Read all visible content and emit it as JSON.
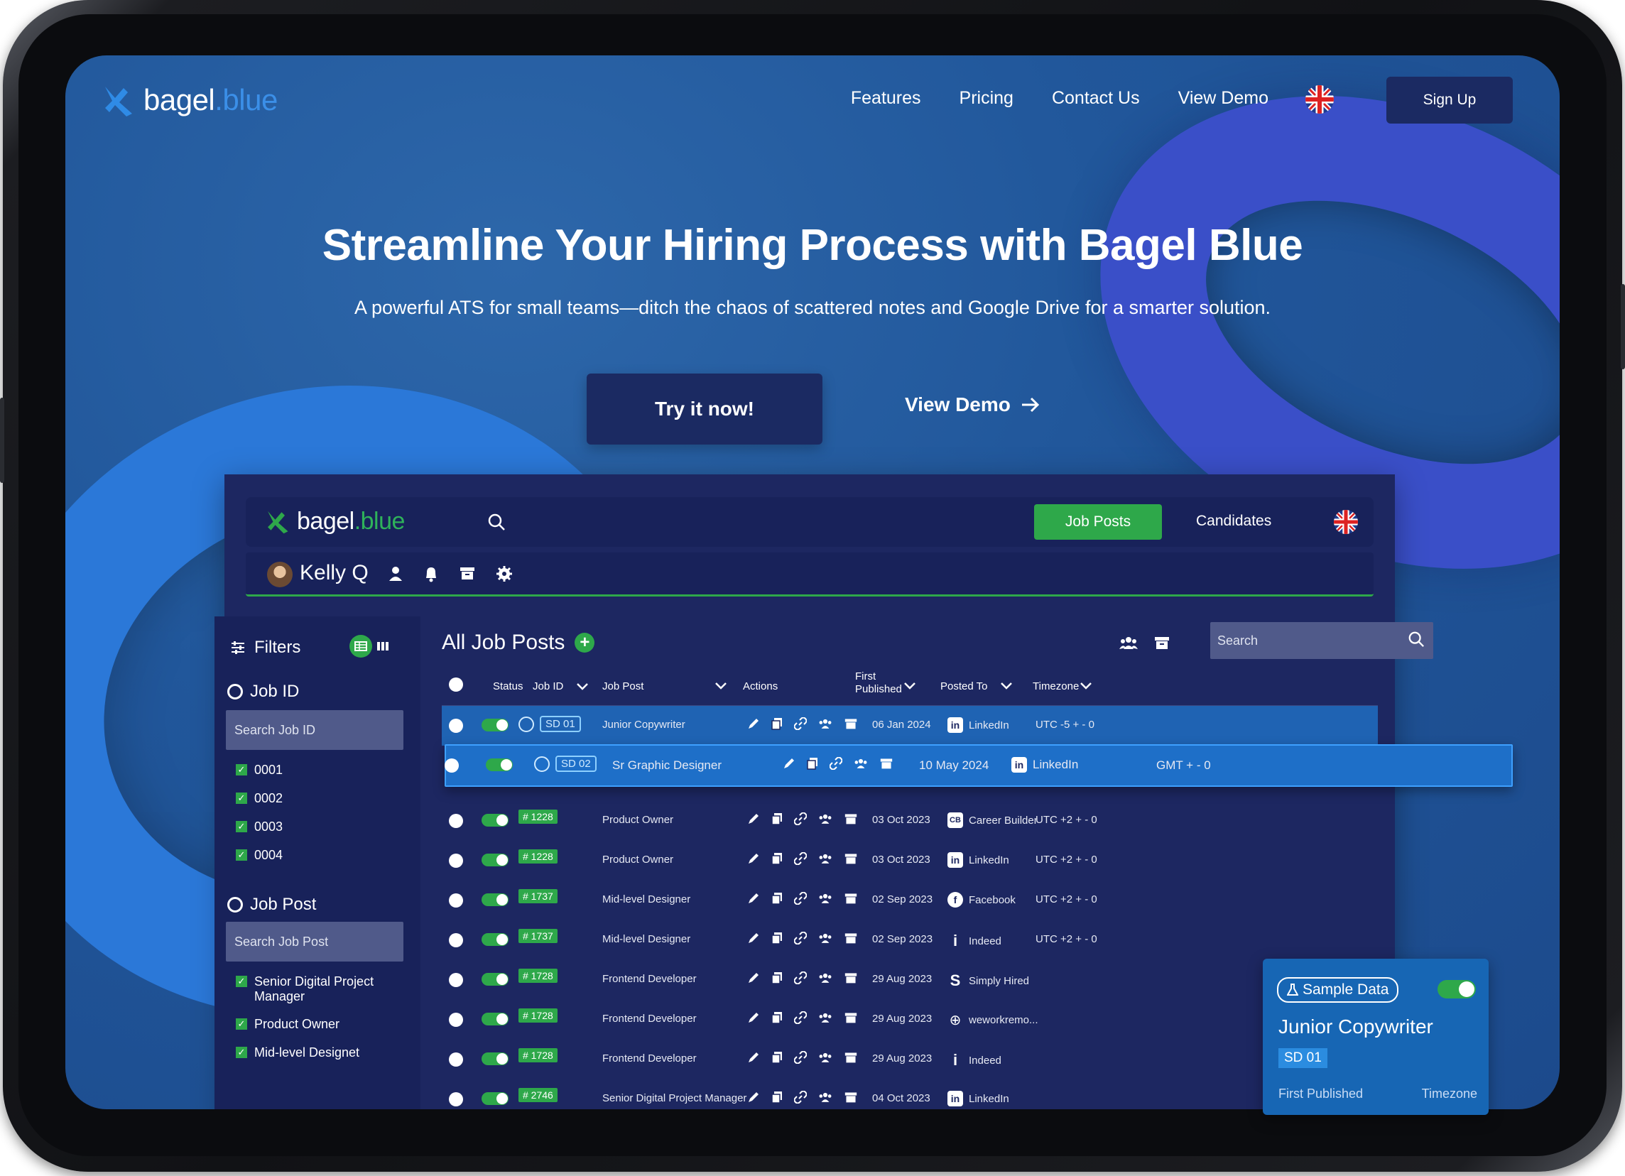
{
  "brand": {
    "name_main": "bagel",
    "name_accent": ".blue"
  },
  "nav": {
    "links": [
      "Features",
      "Pricing",
      "Contact Us",
      "View Demo"
    ],
    "signup_label": "Sign Up"
  },
  "hero": {
    "title": "Streamline Your Hiring Process with Bagel Blue",
    "subtitle": "A powerful ATS for small teams—ditch the chaos of scattered notes and Google Drive for a smarter solution.",
    "cta_primary": "Try it now!",
    "cta_secondary": "View Demo"
  },
  "app": {
    "tabs": {
      "job_posts": "Job Posts",
      "candidates": "Candidates"
    },
    "user_name": "Kelly Q",
    "filters": {
      "title": "Filters",
      "job_id_label": "Job ID",
      "job_id_search_placeholder": "Search Job ID",
      "job_ids": [
        "0001",
        "0002",
        "0003",
        "0004"
      ],
      "job_post_label": "Job Post",
      "job_post_search_placeholder": "Search Job Post",
      "job_posts": [
        "Senior Digital Project Manager",
        "Product Owner",
        "Mid-level Designet"
      ]
    },
    "main": {
      "title": "All Job Posts",
      "search_placeholder": "Search",
      "columns": {
        "status": "Status",
        "job_id": "Job ID",
        "job_post": "Job Post",
        "actions": "Actions",
        "first_published": "First Published",
        "posted_to": "Posted To",
        "timezone": "Timezone"
      },
      "rows": [
        {
          "id": "SD  01",
          "post": "Junior Copywriter",
          "date": "06 Jan 2024",
          "platform": "LinkedIn",
          "tz": "UTC -5 + - 0"
        },
        {
          "id": "SD  02",
          "post": "Sr Graphic Designer",
          "date": "10 May 2024",
          "platform": "LinkedIn",
          "tz": "GMT + - 0"
        },
        {
          "id": "# 1228",
          "post": "Product Owner",
          "date": "03 Oct 2023",
          "platform": "Career Builder",
          "tz": "UTC +2 + - 0"
        },
        {
          "id": "# 1228",
          "post": "Product Owner",
          "date": "03 Oct 2023",
          "platform": "LinkedIn",
          "tz": "UTC +2 + - 0"
        },
        {
          "id": "# 1737",
          "post": "Mid-level Designer",
          "date": "02 Sep 2023",
          "platform": "Facebook",
          "tz": "UTC +2 + - 0"
        },
        {
          "id": "# 1737",
          "post": "Mid-level Designer",
          "date": "02 Sep 2023",
          "platform": "Indeed",
          "tz": "UTC +2 + - 0"
        },
        {
          "id": "# 1728",
          "post": "Frontend Developer",
          "date": "29 Aug 2023",
          "platform": "Simply Hired",
          "tz": ""
        },
        {
          "id": "# 1728",
          "post": "Frontend Developer",
          "date": "29 Aug 2023",
          "platform": "weworkremo...",
          "tz": ""
        },
        {
          "id": "# 1728",
          "post": "Frontend Developer",
          "date": "29 Aug 2023",
          "platform": "Indeed",
          "tz": ""
        },
        {
          "id": "# 2746",
          "post": "Senior Digital Project Manager",
          "date": "04 Oct 2023",
          "platform": "LinkedIn",
          "tz": ""
        }
      ]
    },
    "sample_card": {
      "badge": "Sample Data",
      "title": "Junior Copywriter",
      "id": "SD  01",
      "label_first_published": "First Published",
      "label_timezone": "Timezone"
    }
  },
  "colors": {
    "accent_green": "#2ea84a",
    "brand_blue": "#3b8fe8",
    "navy": "#1b2a62"
  }
}
